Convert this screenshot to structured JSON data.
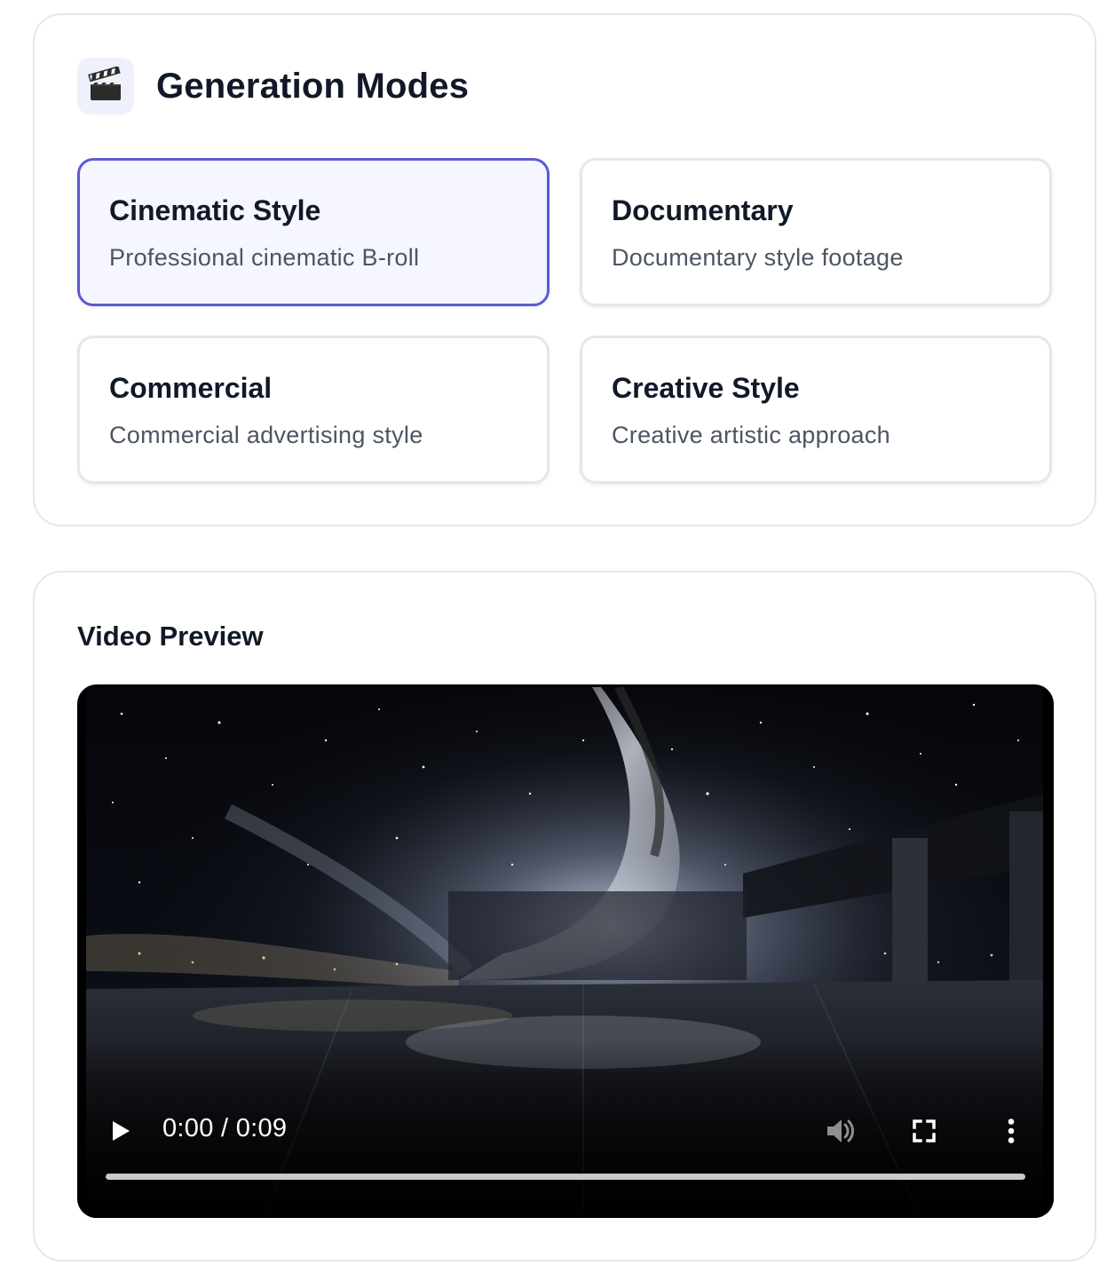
{
  "generation_modes": {
    "title": "Generation Modes",
    "icon": "clapperboard-icon",
    "accent_color": "#5b5bd6",
    "selected": "Cinematic Style",
    "options": [
      {
        "title": "Cinematic Style",
        "description": "Professional cinematic B-roll",
        "selected": true
      },
      {
        "title": "Documentary",
        "description": "Documentary style footage",
        "selected": false
      },
      {
        "title": "Commercial",
        "description": "Commercial advertising style",
        "selected": false
      },
      {
        "title": "Creative Style",
        "description": "Creative artistic approach",
        "selected": false
      }
    ]
  },
  "video_preview": {
    "title": "Video Preview",
    "player": {
      "current_time": "0:00",
      "duration": "0:09",
      "time_display": "0:00 / 0:09",
      "progress": 0,
      "controls": [
        "play-icon",
        "volume-icon",
        "fullscreen-icon",
        "more-options-icon"
      ]
    }
  }
}
